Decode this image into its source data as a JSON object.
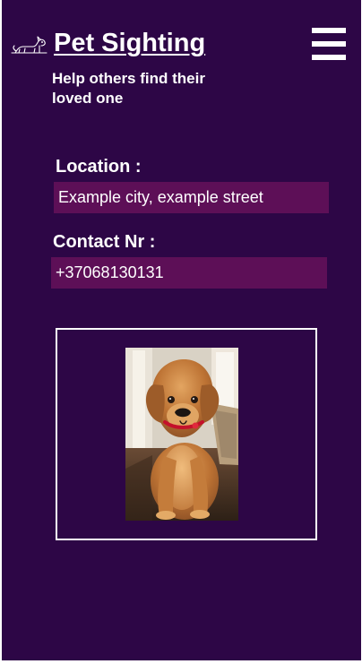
{
  "header": {
    "title": "Pet Sighting",
    "tagline": "Help others find their loved one",
    "logo_icon": "dog-icon",
    "menu_icon": "hamburger-menu-icon"
  },
  "form": {
    "location_label": "Location :",
    "location_value": "Example city, example street",
    "contact_label": "Contact Nr :",
    "contact_value": "+37068130131"
  },
  "photo": {
    "subject": "golden retriever puppy"
  },
  "colors": {
    "background": "#2d0646",
    "input_background": "#5d0f57",
    "text": "#ffffff"
  }
}
